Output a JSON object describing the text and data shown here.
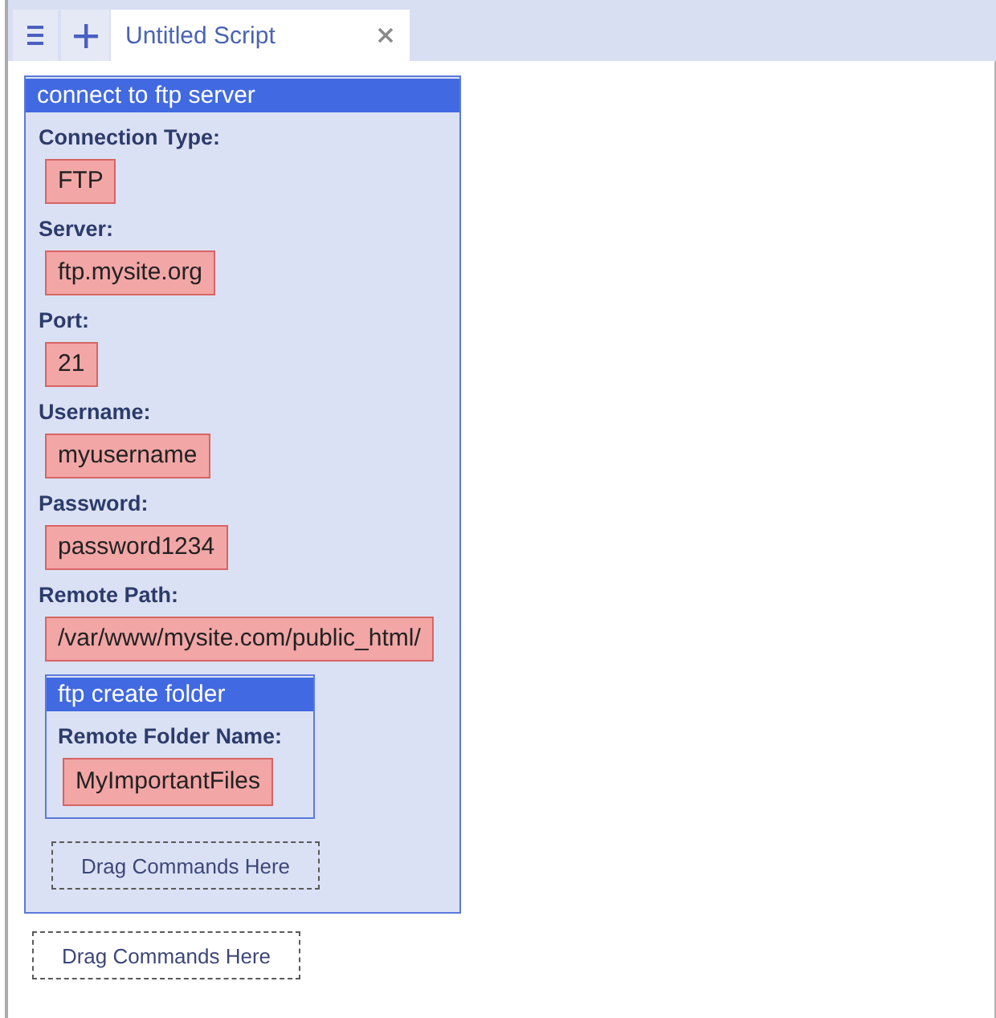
{
  "tabs": [
    {
      "title": "Untitled Script",
      "selected": true
    }
  ],
  "script": {
    "commands": [
      {
        "title": "connect to ftp server",
        "fields": [
          {
            "label": "Connection Type:",
            "value": "FTP"
          },
          {
            "label": "Server:",
            "value": "ftp.mysite.org"
          },
          {
            "label": "Port:",
            "value": "21"
          },
          {
            "label": "Username:",
            "value": "myusername"
          },
          {
            "label": "Password:",
            "value": "password1234"
          },
          {
            "label": "Remote Path:",
            "value": "/var/www/mysite.com/public_html/"
          }
        ],
        "children": [
          {
            "title": "ftp create folder",
            "fields": [
              {
                "label": "Remote Folder Name:",
                "value": "MyImportantFiles"
              }
            ]
          }
        ],
        "drop_zone": "Drag Commands Here"
      }
    ],
    "drop_zone": "Drag Commands Here"
  }
}
